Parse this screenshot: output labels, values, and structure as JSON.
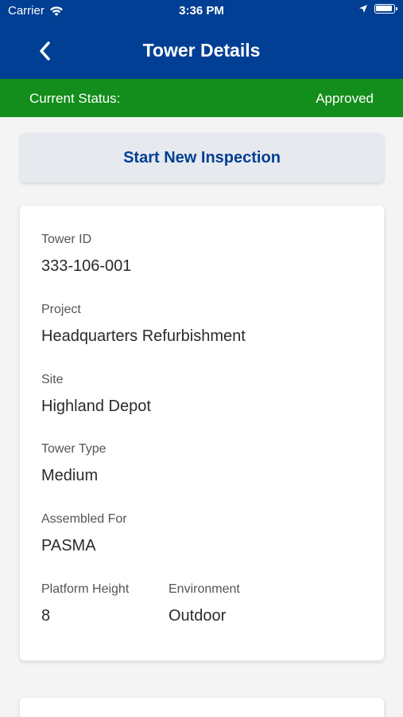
{
  "status_bar": {
    "carrier": "Carrier",
    "time": "3:36 PM"
  },
  "nav": {
    "title": "Tower Details",
    "back_icon": "chevron-left-icon"
  },
  "status": {
    "label": "Current Status:",
    "value": "Approved",
    "color": "#138d1b"
  },
  "actions": {
    "start_inspection": "Start New Inspection"
  },
  "details": {
    "tower_id": {
      "label": "Tower ID",
      "value": "333-106-001"
    },
    "project": {
      "label": "Project",
      "value": "Headquarters Refurbishment"
    },
    "site": {
      "label": "Site",
      "value": "Highland Depot"
    },
    "tower_type": {
      "label": "Tower Type",
      "value": "Medium"
    },
    "assembled_for": {
      "label": "Assembled For",
      "value": "PASMA"
    },
    "platform_height": {
      "label": "Platform Height",
      "value": "8"
    },
    "environment": {
      "label": "Environment",
      "value": "Outdoor"
    }
  },
  "colors": {
    "header": "#003f93",
    "status_approved": "#138d1b",
    "button_text": "#003f93"
  }
}
